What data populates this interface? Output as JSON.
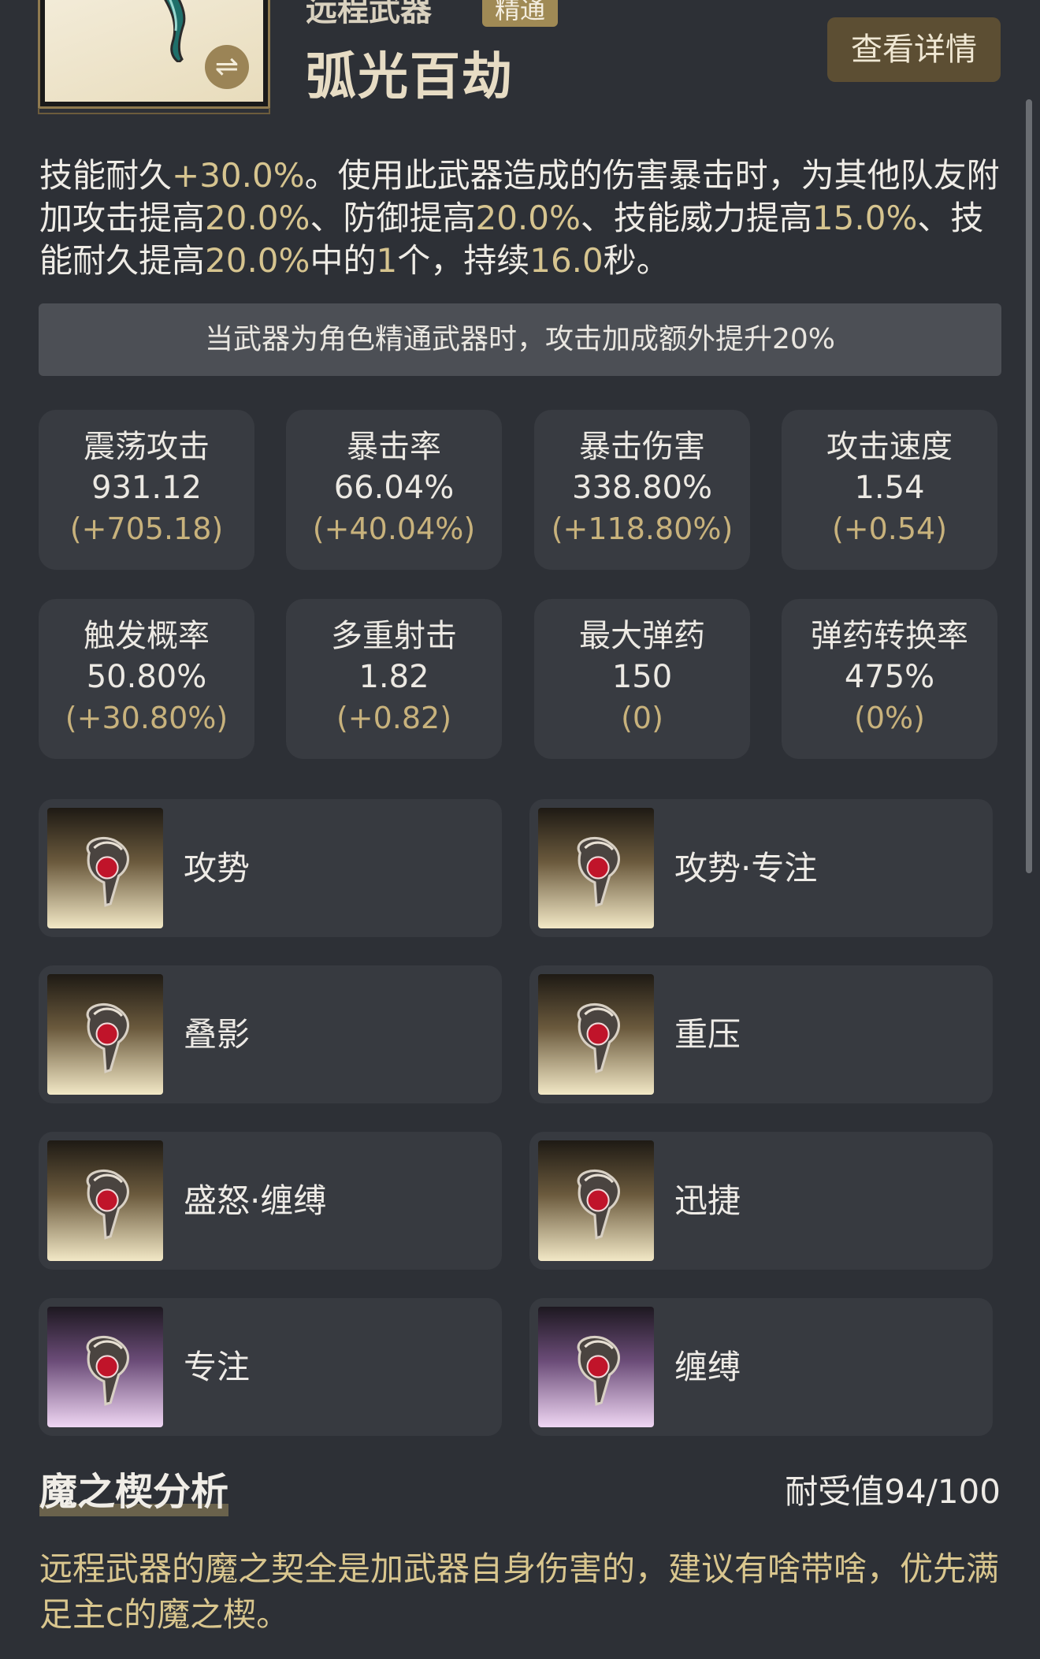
{
  "header": {
    "weapon_type": "远程武器",
    "mastery_badge": "精通",
    "weapon_name": "弧光百劫",
    "detail_button": "查看详情",
    "swap_icon": "⇌"
  },
  "description": {
    "p1": "技能耐久",
    "v1": "+30.0%",
    "p2": "。使用此武器造成的伤害暴击时，为其他队友附加攻击提高",
    "v2": "20.0%",
    "p3": "、防御提高",
    "v3": "20.0%",
    "p4": "、技能威力提高",
    "v4": "15.0%",
    "p5": "、技能耐久提高",
    "v5": "20.0%",
    "p6": "中的",
    "v6": "1",
    "p7": "个，持续",
    "v7": "16.0",
    "p8": "秒。"
  },
  "note": "当武器为角色精通武器时，攻击加成额外提升20%",
  "stats": [
    {
      "label": "震荡攻击",
      "value": "931.12",
      "delta": "(+705.18)"
    },
    {
      "label": "暴击率",
      "value": "66.04%",
      "delta": "(+40.04%)"
    },
    {
      "label": "暴击伤害",
      "value": "338.80%",
      "delta": "(+118.80%)"
    },
    {
      "label": "攻击速度",
      "value": "1.54",
      "delta": "(+0.54)"
    },
    {
      "label": "触发概率",
      "value": "50.80%",
      "delta": "(+30.80%)"
    },
    {
      "label": "多重射击",
      "value": "1.82",
      "delta": "(+0.82)"
    },
    {
      "label": "最大弹药",
      "value": "150",
      "delta": "(0)"
    },
    {
      "label": "弹药转换率",
      "value": "475%",
      "delta": "(0%)"
    }
  ],
  "runes": [
    {
      "name": "攻势",
      "tier": "gold"
    },
    {
      "name": "攻势·专注",
      "tier": "gold"
    },
    {
      "name": "叠影",
      "tier": "gold"
    },
    {
      "name": "重压",
      "tier": "gold"
    },
    {
      "name": "盛怒·缠缚",
      "tier": "gold"
    },
    {
      "name": "迅捷",
      "tier": "gold"
    },
    {
      "name": "专注",
      "tier": "violet"
    },
    {
      "name": "缠缚",
      "tier": "violet"
    }
  ],
  "analysis": {
    "title": "魔之楔分析",
    "durability": "耐受值94/100",
    "text": "远程武器的魔之契全是加武器自身伤害的，建议有啥带啥，优先满足主c的魔之楔。"
  },
  "colors": {
    "background": "#2d3036",
    "highlight": "#d6c48f",
    "accent_gold": "#a08a55"
  }
}
